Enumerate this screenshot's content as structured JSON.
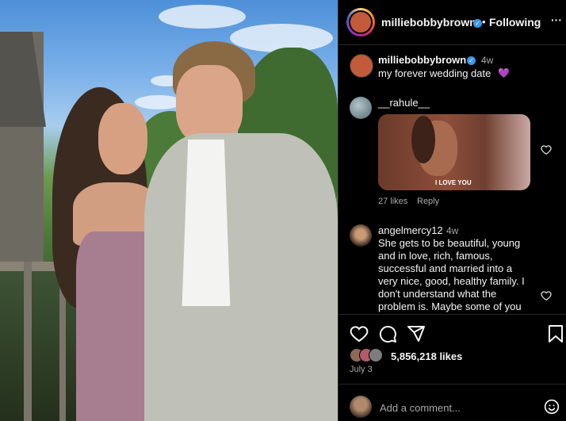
{
  "header": {
    "username": "milliebobbybrown",
    "separator": "•",
    "follow_status": "Following",
    "more_label": "···"
  },
  "caption": {
    "username": "milliebobbybrown",
    "time": "4w",
    "text": "my forever wedding date",
    "emoji": "💜"
  },
  "comments": [
    {
      "username": "__rahule__",
      "gif_caption": "I LOVE YOU",
      "likes": "27 likes",
      "reply_label": "Reply"
    },
    {
      "username": "angelmercy12",
      "time": "4w",
      "lines": [
        "She gets to be beautiful, young",
        "and in love, rich, famous,",
        "successful and married into a",
        "very nice, good, healthy family. I",
        "don't understand what the",
        "problem is. Maybe some of you"
      ]
    }
  ],
  "actions": {
    "likes_count": "5,856,218 likes",
    "date": "July 3"
  },
  "comment_box": {
    "placeholder": "Add a comment..."
  },
  "colors": {
    "background": "#000000",
    "verified": "#3897f0",
    "muted_text": "#a8a8a8",
    "divider": "#262626"
  }
}
